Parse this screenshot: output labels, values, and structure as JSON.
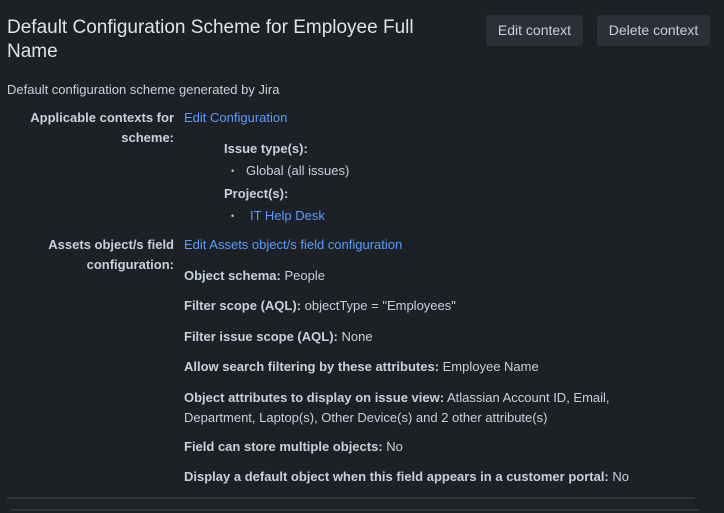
{
  "header": {
    "title": "Default Configuration Scheme for Employee Full Name",
    "edit_context": "Edit context",
    "delete_context": "Delete context"
  },
  "description": "Default configuration scheme generated by Jira",
  "contexts": {
    "label": "Applicable contexts for scheme:",
    "edit_link": "Edit Configuration",
    "issue_types_label": "Issue type(s):",
    "issue_types": [
      "Global (all issues)"
    ],
    "projects_label": "Project(s):",
    "projects": [
      "IT Help Desk"
    ]
  },
  "assets": {
    "label": "Assets object/s field configuration:",
    "edit_link": "Edit Assets object/s field configuration",
    "fields": [
      {
        "name": "Object schema:",
        "value": "People"
      },
      {
        "name": "Filter scope (AQL):",
        "value": "objectType = \"Employees\""
      },
      {
        "name": "Filter issue scope (AQL):",
        "value": "None"
      },
      {
        "name": "Allow search filtering by these attributes:",
        "value": "Employee Name"
      },
      {
        "name": "Object attributes to display on issue view:",
        "value": "Atlassian Account ID, Email, Department, Laptop(s), Other Device(s) and 2 other attribute(s)"
      },
      {
        "name": "Field can store multiple objects:",
        "value": "No"
      },
      {
        "name": "Display a default object when this field appears in a customer portal:",
        "value": "No"
      }
    ]
  }
}
